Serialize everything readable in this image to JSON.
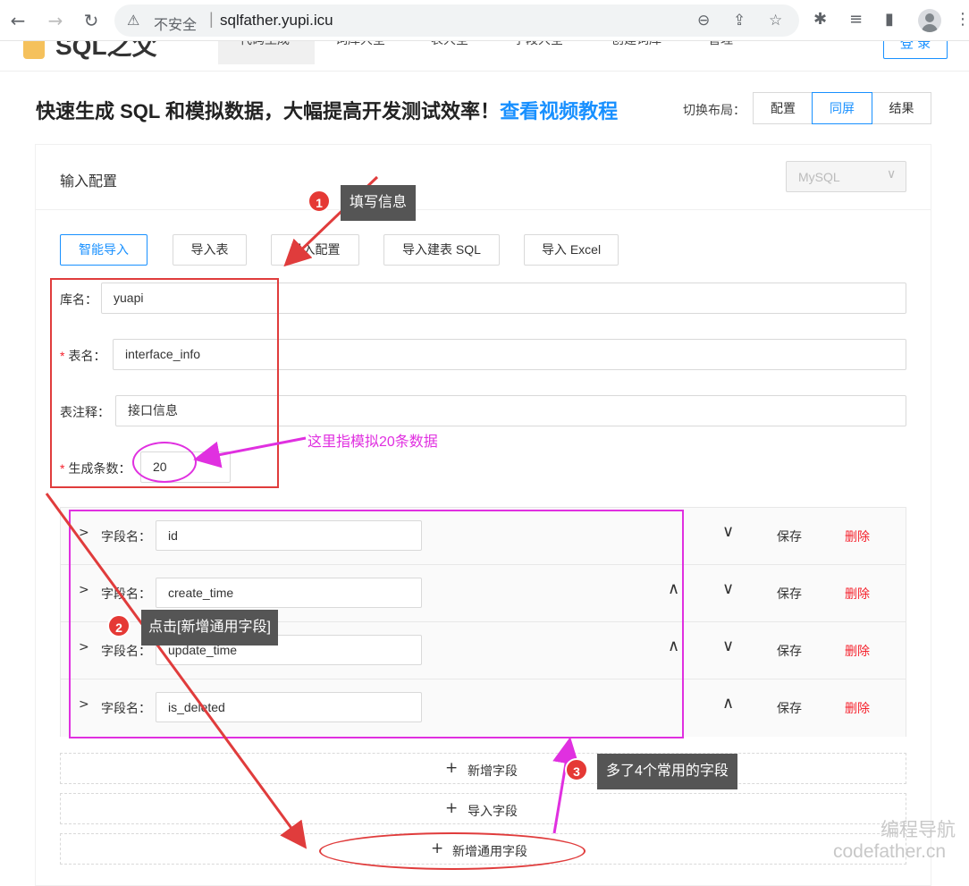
{
  "browser": {
    "insecure_label": "不安全",
    "url": "sqlfather.yupi.icu"
  },
  "header": {
    "logo": "SQL之父",
    "menu": [
      "代码生成",
      "词库大全",
      "表大全",
      "字段大全",
      "创建词库",
      "管理"
    ],
    "login": "登 录"
  },
  "headline": {
    "text": "快速生成 SQL 和模拟数据，大幅提高开发测试效率！",
    "link": "查看视频教程"
  },
  "layout_switch": {
    "label": "切换布局：",
    "options": [
      "配置",
      "同屏",
      "结果"
    ],
    "active": "同屏"
  },
  "card": {
    "title": "输入配置",
    "db_type": "MySQL"
  },
  "import_buttons": [
    "智能导入",
    "导入表",
    "导入配置",
    "导入建表 SQL",
    "导入 Excel"
  ],
  "form": {
    "db_label": "库名：",
    "db_value": "yuapi",
    "table_label": "表名：",
    "table_value": "interface_info",
    "comment_label": "表注释：",
    "comment_value": "接口信息",
    "count_label": "生成条数：",
    "count_value": "20"
  },
  "fields": {
    "label": "字段名：",
    "save": "保存",
    "delete": "删除",
    "rows": [
      {
        "name": "id"
      },
      {
        "name": "create_time"
      },
      {
        "name": "update_time"
      },
      {
        "name": "is_deleted"
      }
    ]
  },
  "actions": {
    "add_field": "新增字段",
    "import_field": "导入字段",
    "add_common_field": "新增通用字段"
  },
  "annotations": {
    "step1_num": "1",
    "step1_text": "填写信息",
    "step2_num": "2",
    "step2_text": "点击[新增通用字段]",
    "step3_num": "3",
    "step3_text": "多了4个常用的字段",
    "count_note": "这里指模拟20条数据"
  },
  "watermark": {
    "line1": "编程导航",
    "line2": "codefather.cn"
  },
  "colors": {
    "primary": "#1890ff",
    "danger": "#f5222d",
    "annotation_red": "#e03c3c",
    "annotation_magenta": "#e030e0"
  }
}
